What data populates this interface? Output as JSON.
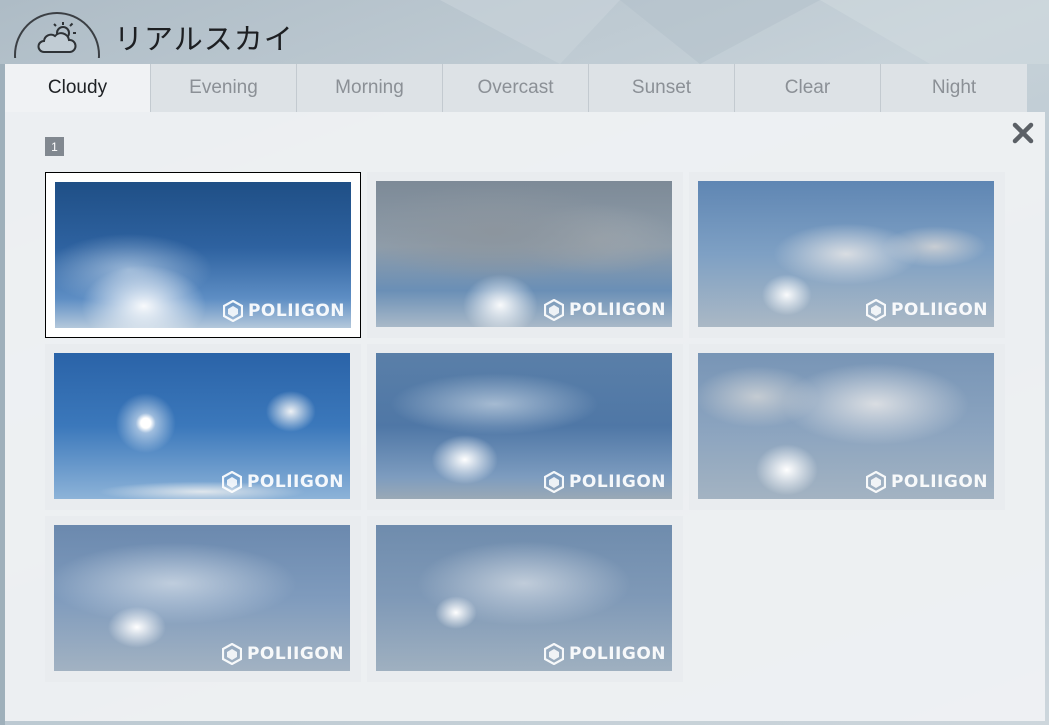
{
  "app": {
    "title": "リアルスカイ"
  },
  "tabs": [
    {
      "label": "Cloudy",
      "active": true
    },
    {
      "label": "Evening",
      "active": false
    },
    {
      "label": "Morning",
      "active": false
    },
    {
      "label": "Overcast",
      "active": false
    },
    {
      "label": "Sunset",
      "active": false
    },
    {
      "label": "Clear",
      "active": false
    },
    {
      "label": "Night",
      "active": false
    }
  ],
  "pagination": {
    "current_page": "1"
  },
  "thumbnails": [
    {
      "watermark": "POLIIGON",
      "selected": true
    },
    {
      "watermark": "POLIIGON",
      "selected": false
    },
    {
      "watermark": "POLIIGON",
      "selected": false
    },
    {
      "watermark": "POLIIGON",
      "selected": false
    },
    {
      "watermark": "POLIIGON",
      "selected": false
    },
    {
      "watermark": "POLIIGON",
      "selected": false
    },
    {
      "watermark": "POLIIGON",
      "selected": false
    },
    {
      "watermark": "POLIIGON",
      "selected": false
    }
  ],
  "icons": {
    "logo": "cloud-sun-icon",
    "close": "close-icon",
    "watermark_logo": "poliigon-logo-icon"
  },
  "colors": {
    "active_tab": "#f0f2f4",
    "inactive_tab": "#dde2e6",
    "badge": "#818890"
  }
}
